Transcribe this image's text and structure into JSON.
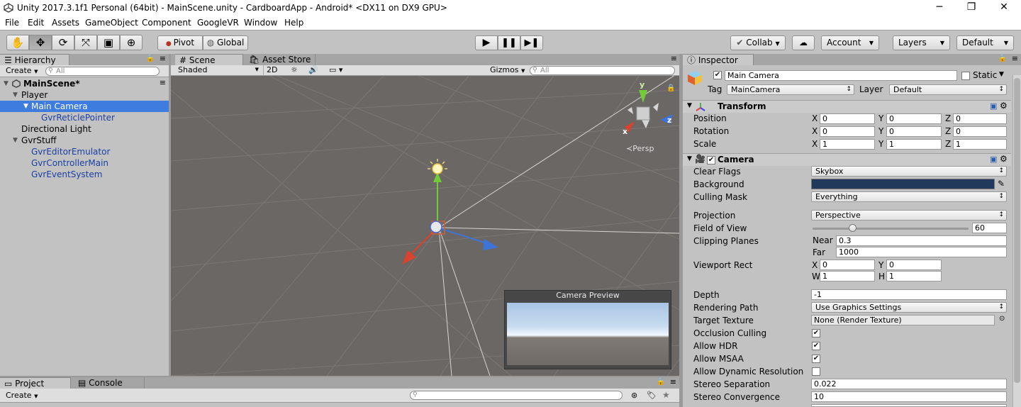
{
  "window": {
    "title": "Unity 2017.3.1f1 Personal (64bit) - MainScene.unity - CardboardApp - Android* <DX11 on DX9 GPU>",
    "minimize": "─",
    "restore": "❐",
    "close": "✕"
  },
  "menu": [
    "File",
    "Edit",
    "Assets",
    "GameObject",
    "Component",
    "GoogleVR",
    "Window",
    "Help"
  ],
  "toolbar": {
    "pivot": "Pivot",
    "global": "Global",
    "collab": "Collab",
    "account": "Account",
    "layers": "Layers",
    "layout": "Default"
  },
  "hierarchy": {
    "tab": "Hierarchy",
    "create": "Create",
    "search_placeholder": "All",
    "scene_name": "MainScene*",
    "items": [
      {
        "label": "Player"
      },
      {
        "label": "Main Camera"
      },
      {
        "label": "GvrReticlePointer"
      },
      {
        "label": "Directional Light"
      },
      {
        "label": "GvrStuff"
      },
      {
        "label": "GvrEditorEmulator"
      },
      {
        "label": "GvrControllerMain"
      },
      {
        "label": "GvrEventSystem"
      }
    ]
  },
  "scene": {
    "tab": "Scene",
    "asset_store_tab": "Asset Store",
    "shading": "Shaded",
    "mode_2d": "2D",
    "gizmos": "Gizmos",
    "search_placeholder": "All",
    "persp": "Persp",
    "gizmo_y": "y",
    "gizmo_z": "z",
    "gizmo_x": "x",
    "camera_preview": "Camera Preview"
  },
  "bottom": {
    "project_tab": "Project",
    "console_tab": "Console",
    "create": "Create"
  },
  "inspector": {
    "tab": "Inspector",
    "object_name": "Main Camera",
    "static_label": "Static",
    "tag_label": "Tag",
    "tag_value": "MainCamera",
    "layer_label": "Layer",
    "layer_value": "Default",
    "transform": {
      "title": "Transform",
      "position_label": "Position",
      "rotation_label": "Rotation",
      "scale_label": "Scale",
      "position": [
        "0",
        "0",
        "0"
      ],
      "rotation": [
        "0",
        "0",
        "0"
      ],
      "scale": [
        "1",
        "1",
        "1"
      ]
    },
    "axis": {
      "x": "X",
      "y": "Y",
      "z": "Z",
      "w": "W",
      "h": "H"
    },
    "camera": {
      "title": "Camera",
      "clear_flags_label": "Clear Flags",
      "clear_flags": "Skybox",
      "background_label": "Background",
      "background_color": "#213a5c",
      "culling_mask_label": "Culling Mask",
      "culling_mask": "Everything",
      "projection_label": "Projection",
      "projection": "Perspective",
      "fov_label": "Field of View",
      "fov": "60",
      "fov_fraction": 0.26,
      "clipping_label": "Clipping Planes",
      "near_label": "Near",
      "near": "0.3",
      "far_label": "Far",
      "far": "1000",
      "viewport_label": "Viewport Rect",
      "viewport": {
        "x": "0",
        "y": "0",
        "w": "1",
        "h": "1"
      },
      "depth_label": "Depth",
      "depth": "-1",
      "rendering_path_label": "Rendering Path",
      "rendering_path": "Use Graphics Settings",
      "target_texture_label": "Target Texture",
      "target_texture": "None (Render Texture)",
      "occlusion_label": "Occlusion Culling",
      "hdr_label": "Allow HDR",
      "msaa_label": "Allow MSAA",
      "dynres_label": "Allow Dynamic Resolution",
      "stereo_sep_label": "Stereo Separation",
      "stereo_sep": "0.022",
      "stereo_conv_label": "Stereo Convergence",
      "stereo_conv": "10"
    }
  }
}
